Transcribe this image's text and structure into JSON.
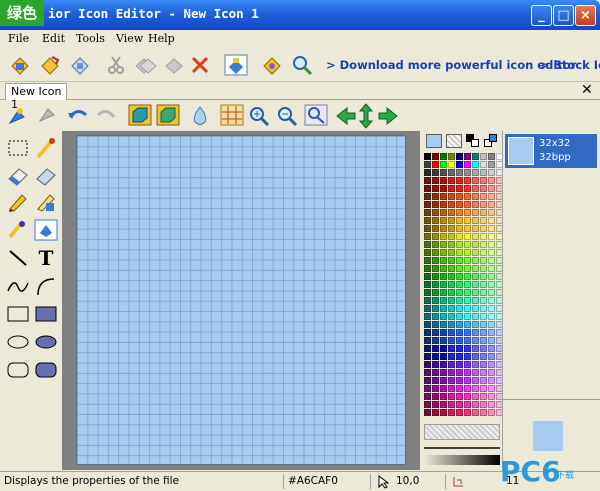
{
  "titlebar": {
    "badge": "绿色",
    "title": "ior Icon Editor - New Icon 1",
    "minimize": "_",
    "maximize": "□",
    "close": "×"
  },
  "menu": [
    "File",
    "Edit",
    "Tools",
    "View",
    "Help"
  ],
  "toolbar": {
    "icons": [
      "new-file-icon",
      "open-file-icon",
      "save-icon",
      "cut-icon",
      "copy-icon",
      "paste-icon",
      "delete-icon",
      "properties-icon",
      "resources-icon",
      "search-icon"
    ],
    "link1": "> Download more powerful icon editor",
    "link2": "> Stock Ic"
  },
  "tab": {
    "label": "New Icon 1",
    "close": "✕"
  },
  "drawing_toolbar": {
    "icons": [
      "hand-icon",
      "pin-icon",
      "undo-icon",
      "redo-icon",
      "box-front-icon",
      "box-back-icon",
      "drop-icon",
      "grid-icon",
      "zoom-in-icon",
      "zoom-out-icon",
      "zoom-actual-icon",
      "arrow-left-icon",
      "move-icon",
      "arrow-right-icon"
    ]
  },
  "tools": {
    "icons": [
      "select-icon",
      "pipette-icon",
      "eraser-icon",
      "eraser-fill-icon",
      "pencil-icon",
      "pencil-fill-icon",
      "brush-icon",
      "fill-icon",
      "line-icon",
      "text-icon",
      "curve-icon",
      "arc-icon",
      "rect-icon",
      "rect-filled-icon",
      "ellipse-icon",
      "ellipse-filled-icon",
      "rounded-rect-icon",
      "rounded-rect-filled-icon"
    ],
    "text_label": "T"
  },
  "format": {
    "line1": "32x32",
    "line2": "32bpp"
  },
  "status": {
    "message": "Displays the properties of the file",
    "color": "#A6CAF0",
    "coords": "10,0",
    "size": "11"
  },
  "watermark": {
    "text": "PC6",
    "sub": "下载"
  },
  "colors": {
    "canvas": "#a6caf0"
  }
}
